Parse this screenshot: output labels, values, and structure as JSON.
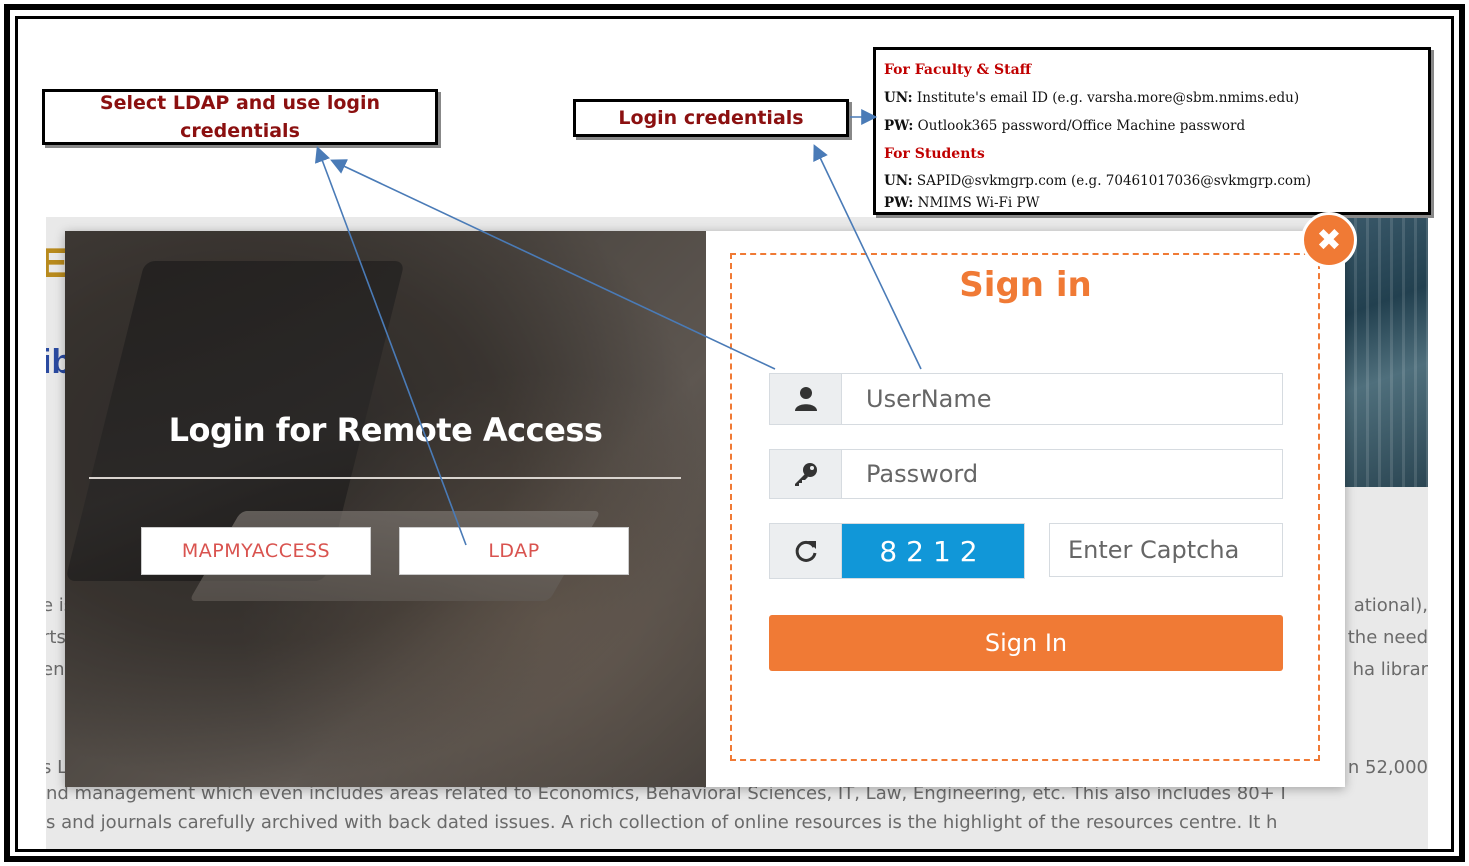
{
  "callouts": {
    "ldap_note": "Select LDAP and use login credentials",
    "credentials_note": "Login credentials"
  },
  "info_box": {
    "faculty_heading": "For Faculty & Staff",
    "faculty_un_label": "UN:",
    "faculty_un_text": " Institute's email ID (e.g. varsha.more@sbm.nmims.edu)",
    "faculty_pw_label": "PW:",
    "faculty_pw_text": " Outlook365 password/Office Machine password",
    "students_heading": "For Students",
    "students_un_label": "UN:",
    "students_un_text": " SAPID@svkmgrp.com (e.g. 70461017036@svkmgrp.com)",
    "students_pw_label": "PW:",
    "students_pw_text": " NMIMS Wi-Fi PW"
  },
  "modal_left": {
    "title": "Login for Remote Access",
    "method_mapmyaccess": "MAPMYACCESS",
    "method_ldap": "LDAP"
  },
  "modal_right": {
    "title": "Sign in",
    "username_placeholder": "UserName",
    "password_placeholder": "Password",
    "captcha_code": "8212",
    "captcha_placeholder": "Enter Captcha",
    "signin_label": "Sign In",
    "close_glyph": "✖"
  },
  "background_site": {
    "logo_fragment": "E",
    "title_fragment": "ib",
    "line1": "nd management which even includes areas related to Economics, Behavioral Sciences, IT, Law, Engineering, etc. This also includes 80+ I",
    "line2": "s and journals carefully archived with back dated issues. A rich collection of online resources is the highlight of the resources centre. It h",
    "right1": "ational),",
    "right2": "the need",
    "right3": "ha librar",
    "right4": "n 52,000",
    "left1": "e is",
    "left2": "rts",
    "left3": "en",
    "left4": "s L"
  },
  "colors": {
    "accent": "#f07a35",
    "captcha_bg": "#1197d8",
    "callout_text": "#8b1010",
    "info_heading": "#c00000",
    "method_text": "#d9534f",
    "arrow": "#4a7bb7"
  }
}
